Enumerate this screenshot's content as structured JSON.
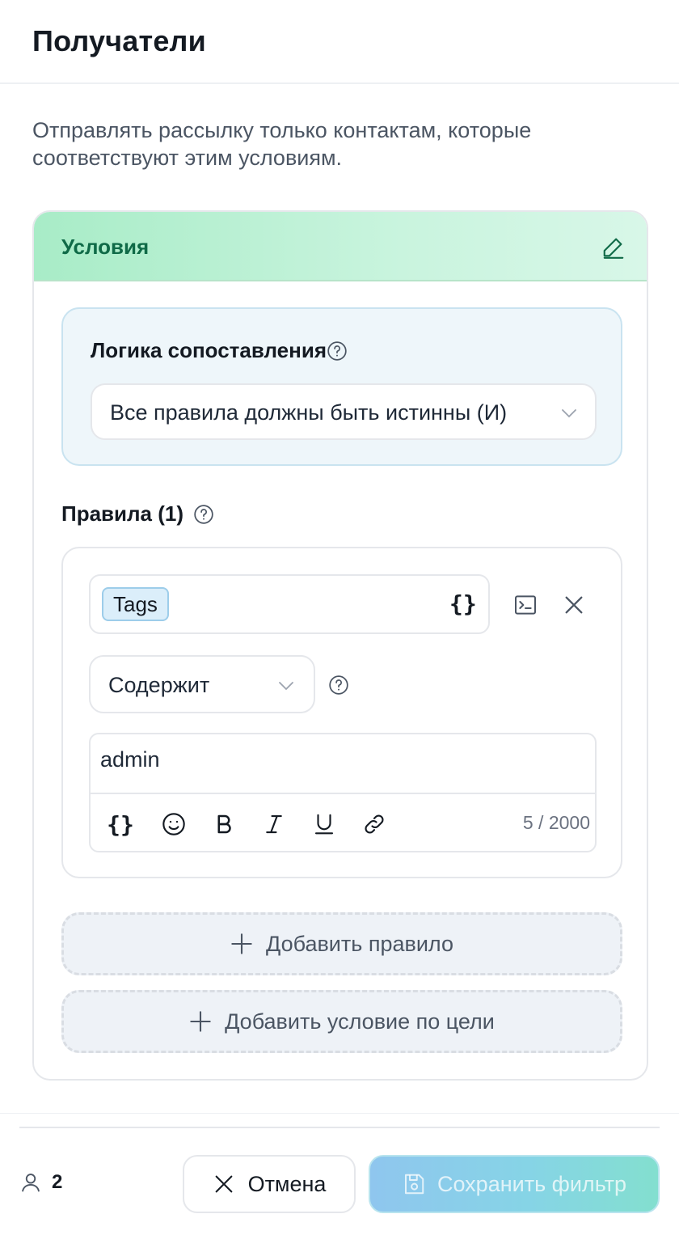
{
  "header": {
    "title": "Получатели"
  },
  "description": "Отправлять рассылку только контактам, которые соответствуют этим условиям.",
  "conditions": {
    "title": "Условия",
    "edit_icon": "pencil-icon",
    "logic": {
      "label": "Логика сопоставления",
      "selected": "Все правила должны быть истинны (И)"
    },
    "rules_title": "Правила (1)",
    "rules": [
      {
        "field_tag": "Tags",
        "variable_symbol": "{}",
        "operator": "Содержит",
        "value": "admin",
        "counter": "5 / 2000",
        "toolbar": [
          "braces-icon",
          "emoji-icon",
          "bold-icon",
          "italic-icon",
          "underline-icon",
          "link-icon"
        ]
      }
    ],
    "add_rule": "Добавить правило",
    "add_goal_condition": "Добавить условие по цели"
  },
  "footer": {
    "recipient_count": "2",
    "cancel_label": "Отмена",
    "save_label": "Сохранить фильтр"
  },
  "colors": {
    "accent_green": "#0f6a47",
    "header_gradient_start": "#a8ecc7",
    "save_gradient_start": "#8fc6ee",
    "save_gradient_end": "#83dfcf"
  }
}
